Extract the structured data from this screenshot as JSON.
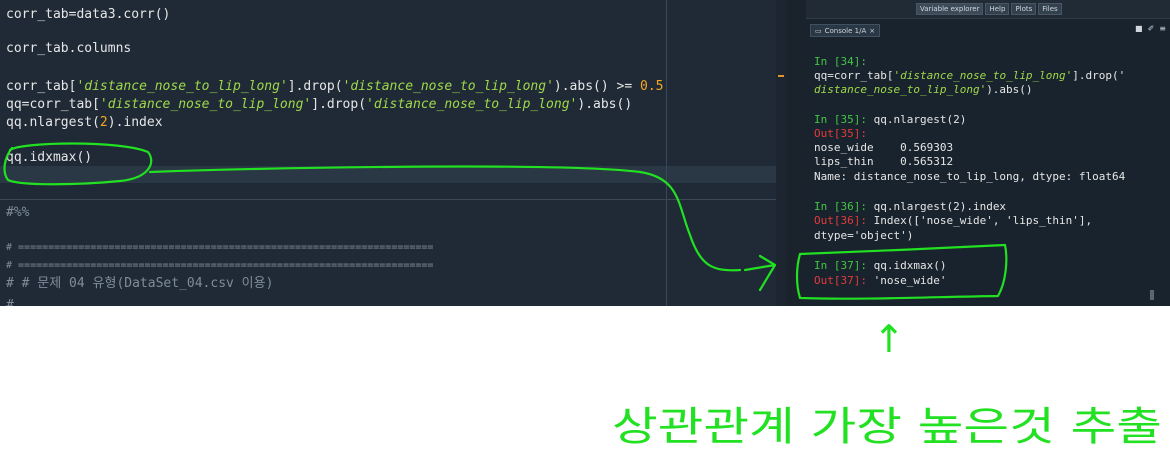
{
  "editor": {
    "lines": [
      {
        "parts": [
          {
            "t": "corr_tab=data3.corr()",
            "k": ""
          }
        ]
      },
      {
        "parts": [
          {
            "t": "corr_tab.columns",
            "k": ""
          }
        ]
      },
      {
        "parts": [
          {
            "t": "corr_tab[",
            "k": ""
          },
          {
            "t": "'distance_nose_to_lip_long'",
            "k": "str"
          },
          {
            "t": "].drop(",
            "k": ""
          },
          {
            "t": "'distance_nose_to_lip_long'",
            "k": "str"
          },
          {
            "t": ").abs() >= ",
            "k": ""
          },
          {
            "t": "0.5",
            "k": "num"
          }
        ]
      },
      {
        "parts": [
          {
            "t": "qq=corr_tab[",
            "k": ""
          },
          {
            "t": "'distance_nose_to_lip_long'",
            "k": "str"
          },
          {
            "t": "].drop(",
            "k": ""
          },
          {
            "t": "'distance_nose_to_lip_long'",
            "k": "str"
          },
          {
            "t": ").abs()",
            "k": ""
          }
        ]
      },
      {
        "parts": [
          {
            "t": "qq.nlargest(",
            "k": ""
          },
          {
            "t": "2",
            "k": "num"
          },
          {
            "t": ").index",
            "k": ""
          }
        ]
      },
      {
        "parts": [
          {
            "t": "qq.idxmax()",
            "k": ""
          }
        ]
      },
      {
        "parts": [
          {
            "t": "#%%",
            "k": "comment"
          }
        ]
      },
      {
        "parts": [
          {
            "t": "# =====================================================================",
            "k": "comment"
          }
        ]
      },
      {
        "parts": [
          {
            "t": "# =====================================================================",
            "k": "comment"
          }
        ]
      },
      {
        "parts": [
          {
            "t": "# # 문제 04 유형(DataSet_04.csv 이용)",
            "k": "comment"
          }
        ]
      },
      {
        "parts": [
          {
            "t": "#",
            "k": "comment"
          }
        ]
      }
    ]
  },
  "right_panel": {
    "tabs": [
      "Variable explorer",
      "Help",
      "Plots",
      "Files"
    ],
    "console_tab": "Console 1/A",
    "console_tab_close": "×",
    "toolbar_icons": [
      "■",
      "✐",
      "≡"
    ]
  },
  "console": {
    "lines": [
      {
        "parts": [
          {
            "t": "In [34]:",
            "k": "in"
          }
        ]
      },
      {
        "parts": [
          {
            "t": "qq=corr_tab[",
            "k": ""
          },
          {
            "t": "'distance_nose_to_lip_long'",
            "k": "str"
          },
          {
            "t": "].drop('",
            "k": ""
          }
        ]
      },
      {
        "parts": [
          {
            "t": "distance_nose_to_lip_long'",
            "k": "str"
          },
          {
            "t": ").abs()",
            "k": ""
          }
        ]
      },
      {
        "parts": [
          {
            "t": "In [35]:",
            "k": "in"
          },
          {
            "t": " qq.nlargest(2)",
            "k": ""
          }
        ]
      },
      {
        "parts": [
          {
            "t": "Out[35]:",
            "k": "out"
          }
        ]
      },
      {
        "parts": [
          {
            "t": "nose_wide    0.569303",
            "k": ""
          }
        ]
      },
      {
        "parts": [
          {
            "t": "lips_thin    0.565312",
            "k": ""
          }
        ]
      },
      {
        "parts": [
          {
            "t": "Name: distance_nose_to_lip_long, dtype: float64",
            "k": ""
          }
        ]
      },
      {
        "parts": [
          {
            "t": "In [36]:",
            "k": "in"
          },
          {
            "t": " qq.nlargest(2).index",
            "k": ""
          }
        ]
      },
      {
        "parts": [
          {
            "t": "Out[36]:",
            "k": "out"
          },
          {
            "t": " Index(['nose_wide', 'lips_thin'],",
            "k": ""
          }
        ]
      },
      {
        "parts": [
          {
            "t": "dtype='object')",
            "k": ""
          }
        ]
      },
      {
        "parts": [
          {
            "t": "In [37]:",
            "k": "in"
          },
          {
            "t": " qq.idxmax()",
            "k": ""
          }
        ]
      },
      {
        "parts": [
          {
            "t": "Out[37]:",
            "k": "out"
          },
          {
            "t": " 'nose_wide'",
            "k": ""
          }
        ]
      }
    ]
  },
  "annotation": {
    "arrow_up": "↑",
    "text": "상관관계 가장 높은것 추출",
    "color": "#22e022"
  }
}
